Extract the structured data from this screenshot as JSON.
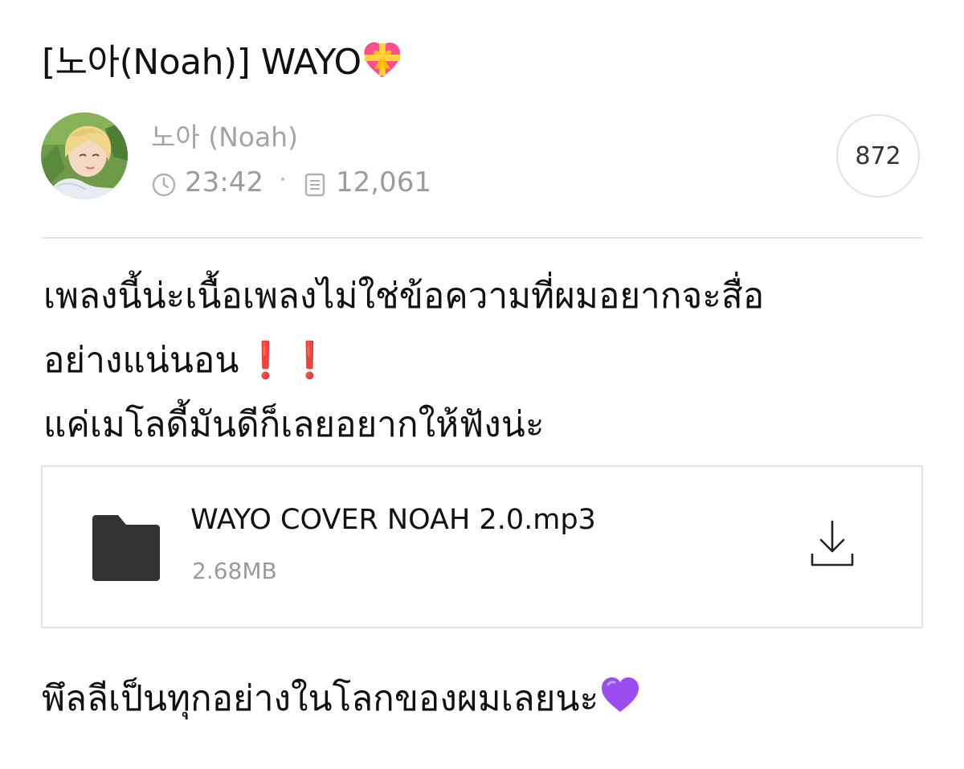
{
  "post": {
    "title": "[노아(Noah)] WAYO",
    "title_emoji": "heart-with-ribbon-icon",
    "author": "노아 (Noah)",
    "time": "23:42",
    "views": "12,061",
    "comment_count": "872",
    "body_lines": [
      "เพลงนี้น่ะเนื้อเพลงไม่ใช่ข้อความที่ผมอยากจะสื่อ",
      "อย่างแน่นอน",
      "แค่เมโลดี้มันดีก็เลยอยากให้ฟังน่ะ"
    ],
    "body_line2_suffix": "❗️❗️",
    "closing": "พึลลีเป็นทุกอย่างในโลกของผมเลยนะ",
    "closing_emoji": "purple-heart-icon"
  },
  "attachment": {
    "file_name": "WAYO COVER NOAH 2.0.mp3",
    "file_size": "2.68MB",
    "icon": "folder-icon",
    "action_icon": "download-icon"
  },
  "colors": {
    "accent_red": "#e4141b",
    "meta_gray": "#9c9c9c",
    "divider": "#e6e6e6",
    "folder": "#333333",
    "purple_heart": "#9b4df0"
  }
}
